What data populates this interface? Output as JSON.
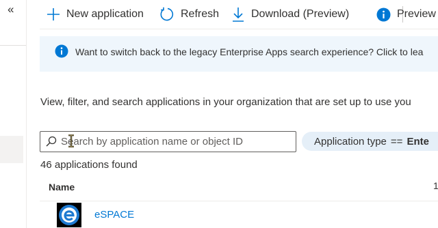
{
  "nav": {
    "collapse_glyph": "«"
  },
  "toolbar": {
    "new_application": {
      "label": "New application",
      "icon": "plus-icon"
    },
    "refresh": {
      "label": "Refresh",
      "icon": "refresh-icon"
    },
    "download": {
      "label": "Download (Preview)",
      "icon": "download-icon"
    },
    "preview": {
      "label": "Preview",
      "icon": "info-icon"
    }
  },
  "banner": {
    "text": "Want to switch back to the legacy Enterprise Apps search experience? Click to lea",
    "icon": "info-icon"
  },
  "description": "View, filter, and search applications in your organization that are set up to use you",
  "search": {
    "placeholder": "Search by application name or object ID",
    "value": ""
  },
  "filter": {
    "field": "Application type",
    "operator": "==",
    "value": "Ente"
  },
  "results": {
    "count_text": "46 applications found"
  },
  "table": {
    "columns": [
      {
        "label": "Name"
      },
      {
        "label": "1"
      }
    ],
    "rows": [
      {
        "name": "eSPACE",
        "logo_glyph": "e"
      }
    ]
  },
  "colors": {
    "accent": "#0078d4",
    "banner_bg": "#eff6fc",
    "pill_bg": "#e5eff8"
  }
}
